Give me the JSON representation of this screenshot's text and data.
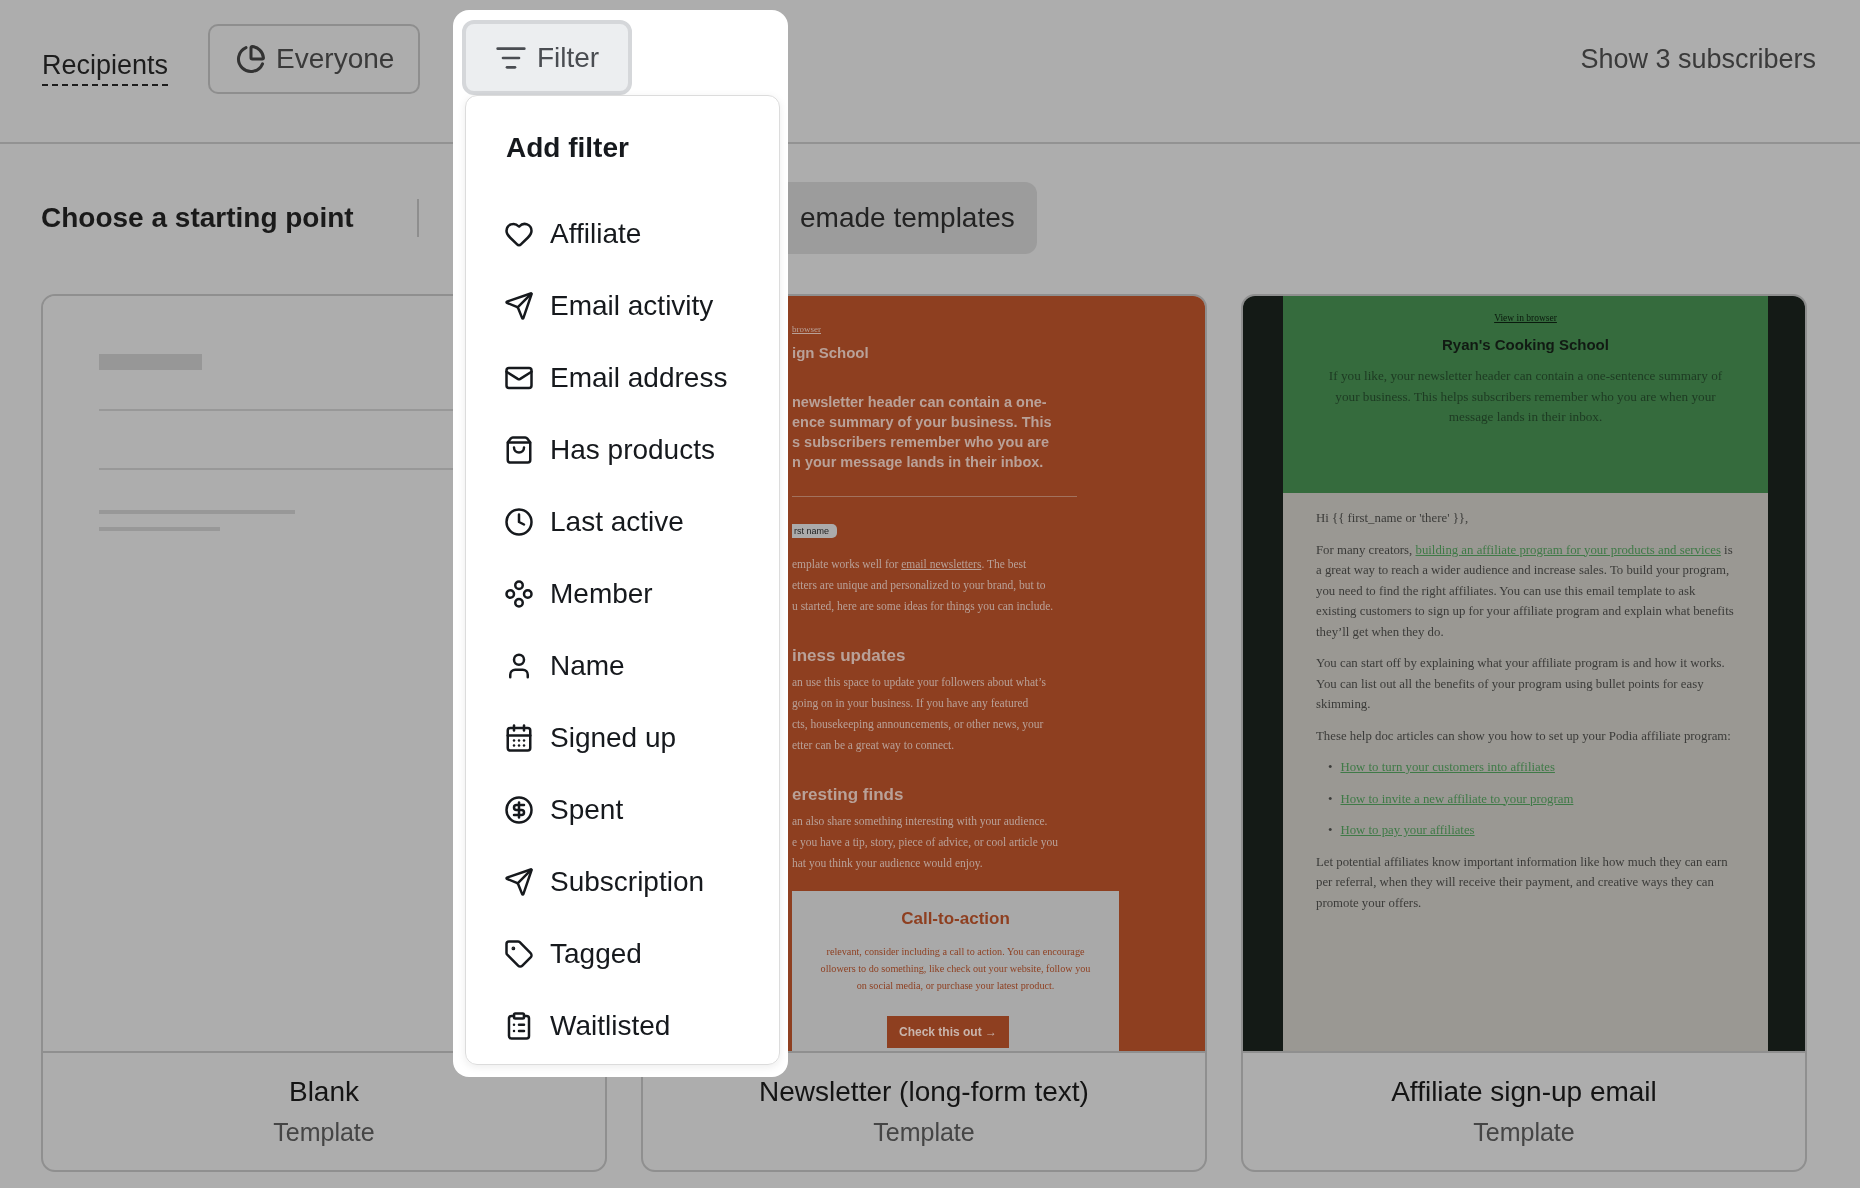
{
  "header": {
    "recipients_label": "Recipients",
    "audience_button": "Everyone",
    "filter_button": {
      "label": "Filter",
      "selected": true
    },
    "subscriber_button": "Show 3 subscribers"
  },
  "filter_menu": {
    "title": "Add filter",
    "items": [
      {
        "label": "Affiliate"
      },
      {
        "label": "Email activity"
      },
      {
        "label": "Email address"
      },
      {
        "label": "Has products"
      },
      {
        "label": "Last active"
      },
      {
        "label": "Member"
      },
      {
        "label": "Name"
      },
      {
        "label": "Signed up"
      },
      {
        "label": "Spent"
      },
      {
        "label": "Subscription"
      },
      {
        "label": "Tagged"
      },
      {
        "label": "Waitlisted"
      }
    ]
  },
  "start": {
    "title": "Choose a starting point",
    "tab": "emade templates"
  },
  "templates": [
    {
      "kind": "blank",
      "title": "Blank",
      "subtitle": "Template"
    },
    {
      "kind": "newsletter",
      "title": "Newsletter (long-form text)",
      "subtitle": "Template",
      "preview": {
        "view_link": "browser",
        "school": "ign School",
        "header_lines": [
          "newsletter header can contain a one-",
          "ence summary of your business. This",
          "s subscribers remember who you are",
          "n your message lands in their inbox."
        ],
        "chip": "rst name",
        "sections": [
          {
            "lines": [
              [
                {
                  "text": "emplate works well for ",
                  "link": false
                },
                {
                  "text": "email newsletters",
                  "link": true
                },
                {
                  "text": ". The best",
                  "link": false
                }
              ],
              [
                {
                  "text": "etters are unique and personalized to your brand, but to",
                  "link": false
                }
              ],
              [
                {
                  "text": "u started, here are some ideas for things you can include.",
                  "link": false
                }
              ]
            ]
          },
          {
            "heading": "iness updates",
            "lines": [
              [
                {
                  "text": "an use this space to update your followers about what’s",
                  "link": false
                }
              ],
              [
                {
                  "text": "going on in your business. If you have any featured",
                  "link": false
                }
              ],
              [
                {
                  "text": "cts, housekeeping announcements, or other news, your",
                  "link": false
                }
              ],
              [
                {
                  "text": "etter can be a great way to connect.",
                  "link": false
                }
              ]
            ]
          },
          {
            "heading": "eresting finds",
            "lines": [
              [
                {
                  "text": "an also share something interesting with your audience.",
                  "link": false
                }
              ],
              [
                {
                  "text": "e you have a tip, story, piece of advice, or cool article you",
                  "link": false
                }
              ],
              [
                {
                  "text": "hat you think your audience would enjoy.",
                  "link": false
                }
              ]
            ]
          }
        ],
        "cta": {
          "title": "Call-to-action",
          "lines": [
            "relevant, consider including a call to action. You can encourage",
            "ollowers to do something, like check out your website, follow you",
            "on social media, or purchase your latest product."
          ],
          "button": "Check this out →"
        }
      }
    },
    {
      "kind": "affiliate",
      "title": "Affiliate sign-up email",
      "subtitle": "Template",
      "preview": {
        "view_link": "View in browser",
        "school": "Ryan's Cooking School",
        "intro": "If you like, your newsletter header can contain a one-sentence summary of your business. This helps subscribers remember who you are when your message lands in their inbox.",
        "greeting": "Hi {{ first_name or 'there' }},",
        "paragraphs": [
          [
            {
              "text": "For many creators, ",
              "link": false
            },
            {
              "text": "building an affiliate program for your products and services",
              "link": true
            },
            {
              "text": " is a great way to reach a wider audience and increase sales. To build your program, you need to find the right affiliates. You can use this email template to ask existing customers to sign up for your affiliate program and explain what benefits they’ll get when they do.",
              "link": false
            }
          ],
          [
            {
              "text": "You can start off by explaining what your affiliate program is and how it works. You can list out all the benefits of your program using bullet points for easy skimming.",
              "link": false
            }
          ],
          [
            {
              "text": "These help doc articles can show you how to set up your Podia affiliate program:",
              "link": false
            }
          ]
        ],
        "links": [
          {
            "bullet": "•",
            "text": "How to turn your customers into affiliates"
          },
          {
            "bullet": "•",
            "text": "How to invite a new affiliate to your program"
          },
          {
            "bullet": "•",
            "text": "How to pay your affiliates"
          }
        ],
        "closing": "Let potential affiliates know important information like how much they can earn per referral, when they will receive their payment, and creative ways they can promote your offers."
      }
    }
  ]
}
